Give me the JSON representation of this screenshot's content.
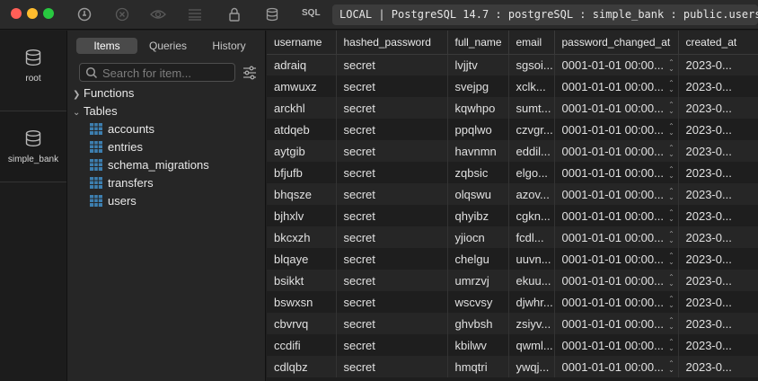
{
  "window": {
    "sql_label": "SQL",
    "connection": "LOCAL | PostgreSQL 14.7 : postgreSQL : simple_bank : public.users"
  },
  "databases": [
    {
      "label": "root",
      "icon": "database-icon"
    },
    {
      "label": "simple_bank",
      "icon": "database-icon"
    }
  ],
  "sidebar": {
    "tabs": [
      {
        "label": "Items"
      },
      {
        "label": "Queries"
      },
      {
        "label": "History"
      }
    ],
    "active_tab": "Items",
    "search_placeholder": "Search for item...",
    "sections": [
      {
        "label": "Functions",
        "expanded": false
      },
      {
        "label": "Tables",
        "expanded": true
      }
    ],
    "tables": [
      {
        "label": "accounts"
      },
      {
        "label": "entries"
      },
      {
        "label": "schema_migrations"
      },
      {
        "label": "transfers"
      },
      {
        "label": "users"
      }
    ]
  },
  "grid": {
    "columns": [
      {
        "label": "username"
      },
      {
        "label": "hashed_password"
      },
      {
        "label": "full_name"
      },
      {
        "label": "email"
      },
      {
        "label": "password_changed_at"
      },
      {
        "label": "created_at"
      }
    ],
    "rows": [
      {
        "username": "adraiq",
        "hashed_password": "secret",
        "full_name": "lvjjtv",
        "email": "sgsoi...",
        "password_changed_at": "0001-01-01 00:00...",
        "created_at": "2023-0..."
      },
      {
        "username": "amwuxz",
        "hashed_password": "secret",
        "full_name": "svejpg",
        "email": "xclk...",
        "password_changed_at": "0001-01-01 00:00...",
        "created_at": "2023-0..."
      },
      {
        "username": "arckhl",
        "hashed_password": "secret",
        "full_name": "kqwhpo",
        "email": "sumt...",
        "password_changed_at": "0001-01-01 00:00...",
        "created_at": "2023-0..."
      },
      {
        "username": "atdqeb",
        "hashed_password": "secret",
        "full_name": "ppqlwo",
        "email": "czvgr...",
        "password_changed_at": "0001-01-01 00:00...",
        "created_at": "2023-0..."
      },
      {
        "username": "aytgib",
        "hashed_password": "secret",
        "full_name": "havnmn",
        "email": "eddil...",
        "password_changed_at": "0001-01-01 00:00...",
        "created_at": "2023-0..."
      },
      {
        "username": "bfjufb",
        "hashed_password": "secret",
        "full_name": "zqbsic",
        "email": "elgo...",
        "password_changed_at": "0001-01-01 00:00...",
        "created_at": "2023-0..."
      },
      {
        "username": "bhqsze",
        "hashed_password": "secret",
        "full_name": "olqswu",
        "email": "azov...",
        "password_changed_at": "0001-01-01 00:00...",
        "created_at": "2023-0..."
      },
      {
        "username": "bjhxlv",
        "hashed_password": "secret",
        "full_name": "qhyibz",
        "email": "cgkn...",
        "password_changed_at": "0001-01-01 00:00...",
        "created_at": "2023-0..."
      },
      {
        "username": "bkcxzh",
        "hashed_password": "secret",
        "full_name": "yjiocn",
        "email": "fcdl...",
        "password_changed_at": "0001-01-01 00:00...",
        "created_at": "2023-0..."
      },
      {
        "username": "blqaye",
        "hashed_password": "secret",
        "full_name": "chelgu",
        "email": "uuvn...",
        "password_changed_at": "0001-01-01 00:00...",
        "created_at": "2023-0..."
      },
      {
        "username": "bsikkt",
        "hashed_password": "secret",
        "full_name": "umrzvj",
        "email": "ekuu...",
        "password_changed_at": "0001-01-01 00:00...",
        "created_at": "2023-0..."
      },
      {
        "username": "bswxsn",
        "hashed_password": "secret",
        "full_name": "wscvsy",
        "email": "djwhr...",
        "password_changed_at": "0001-01-01 00:00...",
        "created_at": "2023-0..."
      },
      {
        "username": "cbvrvq",
        "hashed_password": "secret",
        "full_name": "ghvbsh",
        "email": "zsiyv...",
        "password_changed_at": "0001-01-01 00:00...",
        "created_at": "2023-0..."
      },
      {
        "username": "ccdifi",
        "hashed_password": "secret",
        "full_name": "kbilwv",
        "email": "qwml...",
        "password_changed_at": "0001-01-01 00:00...",
        "created_at": "2023-0..."
      },
      {
        "username": "cdlqbz",
        "hashed_password": "secret",
        "full_name": "hmqtri",
        "email": "ywqj...",
        "password_changed_at": "0001-01-01 00:00...",
        "created_at": "2023-0..."
      }
    ]
  }
}
